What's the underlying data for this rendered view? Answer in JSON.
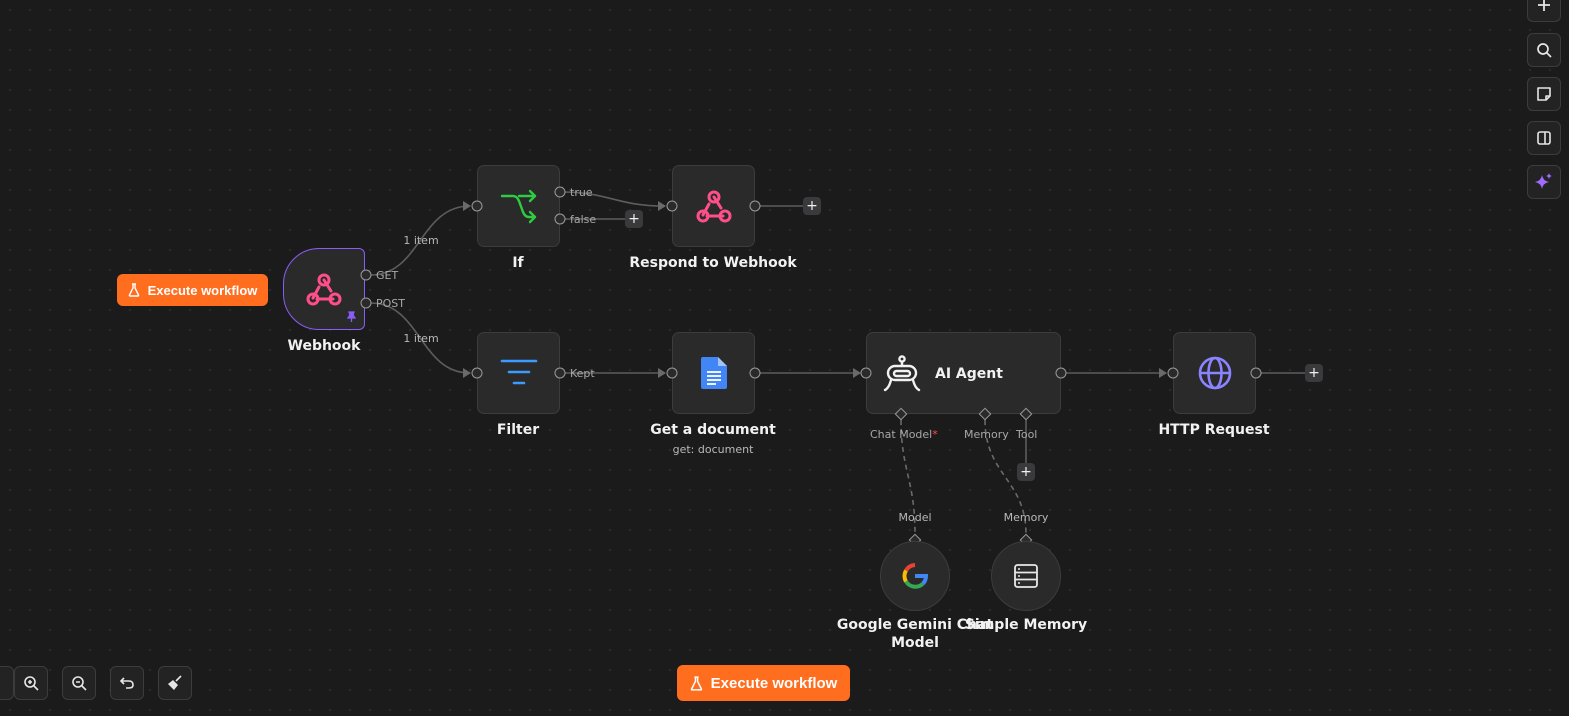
{
  "colors": {
    "canvas": "#1b1b1c",
    "node_bg": "#2a2a2b",
    "accent_orange": "#ff6d1f",
    "trigger_border": "#8b5cf6",
    "webhook_pink": "#ff4f8b",
    "if_green": "#2ecc40",
    "filter_blue": "#3b9cff",
    "docs_blue": "#4285f4",
    "http_purple": "#8b84ff"
  },
  "toolbar_top_right": [
    {
      "icon": "plus-icon"
    },
    {
      "icon": "search-icon"
    },
    {
      "icon": "sticky-note-icon"
    },
    {
      "icon": "panel-icon"
    },
    {
      "icon": "sparkle-icon"
    }
  ],
  "execute_button_label": "Execute workflow",
  "nodes": {
    "webhook": {
      "label": "Webhook",
      "outputs": [
        "GET",
        "POST"
      ]
    },
    "if": {
      "label": "If",
      "outputs": [
        "true",
        "false"
      ]
    },
    "respond": {
      "label": "Respond to Webhook"
    },
    "filter": {
      "label": "Filter",
      "outputs": [
        "Kept"
      ]
    },
    "get_document": {
      "label": "Get a document",
      "subtitle": "get: document"
    },
    "ai_agent": {
      "label": "AI Agent",
      "inputs": [
        "Chat Model",
        "Memory",
        "Tool"
      ],
      "required_marker": "*"
    },
    "http": {
      "label": "HTTP Request"
    },
    "gemini": {
      "label_line1": "Google Gemini Chat",
      "label_line2": "Model",
      "connector": "Model"
    },
    "memory": {
      "label": "Simple Memory",
      "connector": "Memory"
    }
  },
  "edges": {
    "webhook_get_to_if": "1 item",
    "webhook_post_to_filter": "1 item"
  },
  "plus_symbol": "+"
}
